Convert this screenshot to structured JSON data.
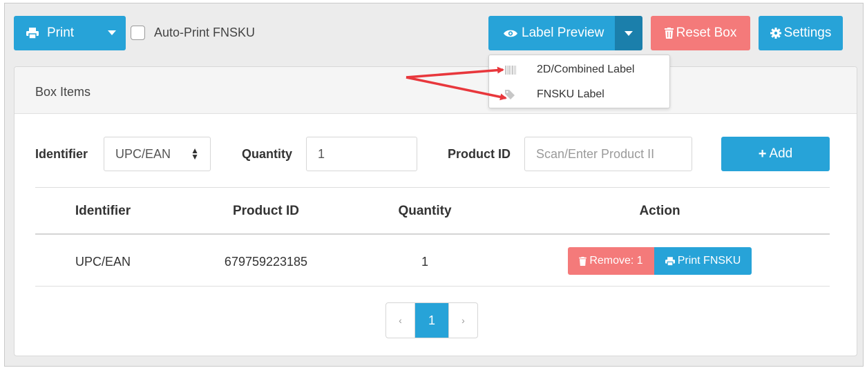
{
  "toolbar": {
    "print_label": "Print",
    "auto_print_label": "Auto-Print FNSKU",
    "label_preview_label": "Label Preview",
    "reset_box_label": "Reset Box",
    "settings_label": "Settings"
  },
  "label_preview_menu": {
    "items": [
      {
        "label": "2D/Combined Label",
        "icon": "barcode-icon"
      },
      {
        "label": "FNSKU Label",
        "icon": "tag-icon"
      }
    ]
  },
  "box_items": {
    "title": "Box Items",
    "form": {
      "identifier_label": "Identifier",
      "identifier_value": "UPC/EAN",
      "quantity_label": "Quantity",
      "quantity_value": "1",
      "product_id_label": "Product ID",
      "product_id_placeholder": "Scan/Enter Product II",
      "add_label": "Add"
    },
    "table": {
      "headers": [
        "Identifier",
        "Product ID",
        "Quantity",
        "Action"
      ],
      "rows": [
        {
          "identifier": "UPC/EAN",
          "product_id": "679759223185",
          "quantity": "1",
          "remove_label": "Remove: 1",
          "print_label": "Print FNSKU"
        }
      ]
    },
    "pagination": {
      "prev": "‹",
      "current": "1",
      "next": "›"
    }
  },
  "colors": {
    "primary": "#27a3d8",
    "primary_dark": "#1b7fab",
    "danger": "#f47a7a",
    "annotation_arrow": "#e8373c"
  }
}
